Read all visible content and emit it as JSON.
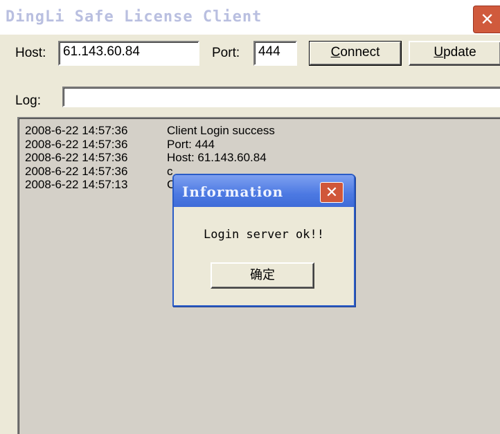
{
  "window": {
    "title": "DingLi Safe License Client",
    "close_glyph": "✕"
  },
  "connection": {
    "host_label": "Host:",
    "host_value": "61.143.60.84",
    "port_label": "Port:",
    "port_value": "444",
    "connect_button": "Connect",
    "update_button": "Update"
  },
  "log": {
    "label": "Log:",
    "status_value": "",
    "entries": [
      {
        "time": "2008-6-22 14:57:36",
        "message": "Client Login success"
      },
      {
        "time": "2008-6-22 14:57:36",
        "message": "Port:  444"
      },
      {
        "time": "2008-6-22 14:57:36",
        "message": "Host:  61.143.60.84"
      },
      {
        "time": "2008-6-22 14:57:36",
        "message": "c"
      },
      {
        "time": "2008-6-22 14:57:13",
        "message": "C"
      }
    ]
  },
  "dialog": {
    "title": "Information",
    "close_glyph": "✕",
    "message": "Login server ok!!",
    "ok_button": "确定"
  },
  "colors": {
    "window_bg": "#ece9d8",
    "dialog_title": "#4c79e2",
    "close_button": "#d0573a"
  }
}
